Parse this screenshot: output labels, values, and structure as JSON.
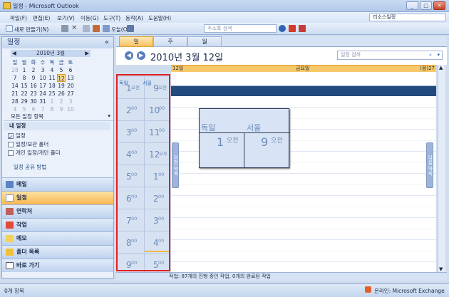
{
  "window": {
    "title": "일정 - Microsoft Outlook"
  },
  "menu": [
    "파일(F)",
    "편집(E)",
    "보기(V)",
    "이동(G)",
    "도구(T)",
    "동작(A)",
    "도움말(H)"
  ],
  "account_box": "리소스일정",
  "toolbar": {
    "new": "새로 만들기(N)",
    "today": "오늘(O)",
    "address_search_placeholder": "주소록 검색"
  },
  "nav": {
    "title": "일정",
    "collapse": "«",
    "mini_cal": {
      "month": "2010년 3월",
      "weekdays": [
        "일",
        "월",
        "화",
        "수",
        "목",
        "금",
        "토"
      ],
      "weeks": [
        [
          "28",
          "1",
          "2",
          "3",
          "4",
          "5",
          "6"
        ],
        [
          "7",
          "8",
          "9",
          "10",
          "11",
          "12",
          "13"
        ],
        [
          "14",
          "15",
          "16",
          "17",
          "18",
          "19",
          "20"
        ],
        [
          "21",
          "22",
          "23",
          "24",
          "25",
          "26",
          "27"
        ],
        [
          "28",
          "29",
          "30",
          "31",
          "1",
          "2",
          "3"
        ],
        [
          "4",
          "5",
          "6",
          "7",
          "8",
          "9",
          "10"
        ]
      ]
    },
    "all_items": "모든 일정 항목",
    "my_calendars": "내 일정",
    "calendars": [
      "일정",
      "일정/보관 폴더",
      "개인 일정/개인 폴더"
    ],
    "share_link": "일정 공유 방법",
    "buttons": [
      "메일",
      "일정",
      "연락처",
      "작업",
      "메모",
      "폴더 목록",
      "바로 가기"
    ]
  },
  "view_tabs": [
    "일",
    "주",
    "월"
  ],
  "header": {
    "date": "2010년 3월 12일",
    "search_placeholder": "일정 검색",
    "back": "◀",
    "forward": "▶"
  },
  "day": {
    "num": "12일",
    "weekday": "금요일",
    "right": "(음)27"
  },
  "timezones": {
    "tz1_label": "독일",
    "tz2_label": "서울",
    "tz1_hours": [
      [
        "1",
        "오전"
      ],
      [
        "2",
        "00"
      ],
      [
        "3",
        "00"
      ],
      [
        "4",
        "00"
      ],
      [
        "5",
        "00"
      ],
      [
        "6",
        "00"
      ],
      [
        "7",
        "00"
      ],
      [
        "8",
        "00"
      ],
      [
        "9",
        "00"
      ]
    ],
    "tz2_hours": [
      [
        "9",
        "오전"
      ],
      [
        "10",
        "00"
      ],
      [
        "11",
        "00"
      ],
      [
        "12",
        "오후"
      ],
      [
        "1",
        "00"
      ],
      [
        "2",
        "00"
      ],
      [
        "3",
        "00"
      ],
      [
        "4",
        "00"
      ],
      [
        "5",
        "00"
      ]
    ]
  },
  "side_tabs": {
    "prev": "이전 약속",
    "next": "다음 약속"
  },
  "popup": {
    "tz1": "독일",
    "tz2": "서울",
    "h1": "1",
    "m1": "오전",
    "h2": "9",
    "m2": "오전"
  },
  "status": "작업: 87개의 진행 중인 작업, 0개의 완료된 작업",
  "bottom": {
    "items": "0개 항목",
    "online": "온라인: Microsoft Exchange"
  }
}
